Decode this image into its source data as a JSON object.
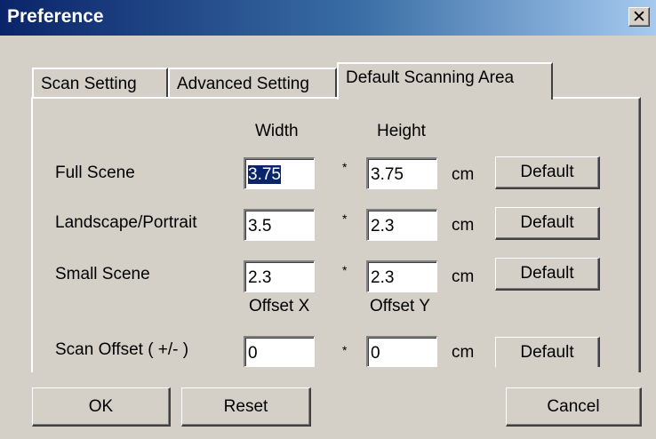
{
  "window": {
    "title": "Preference"
  },
  "tabs": [
    "Scan Setting",
    "Advanced Setting",
    "Default Scanning Area"
  ],
  "columns": {
    "width": "Width",
    "height": "Height",
    "offset_x": "Offset X",
    "offset_y": "Offset Y"
  },
  "rows": [
    {
      "label": "Full Scene",
      "width": "3.75",
      "height": "3.75",
      "times": "*",
      "unit": "cm",
      "button": "Default"
    },
    {
      "label": "Landscape/Portrait",
      "width": "3.5",
      "height": "2.3",
      "times": "*",
      "unit": "cm",
      "button": "Default"
    },
    {
      "label": "Small Scene",
      "width": "2.3",
      "height": "2.3",
      "times": "*",
      "unit": "cm",
      "button": "Default"
    },
    {
      "label": "Scan Offset ( +/- )",
      "width": "0",
      "height": "0",
      "times": "*",
      "unit": "cm",
      "button": "Default"
    }
  ],
  "footer": {
    "ok": "OK",
    "reset": "Reset",
    "cancel": "Cancel"
  }
}
